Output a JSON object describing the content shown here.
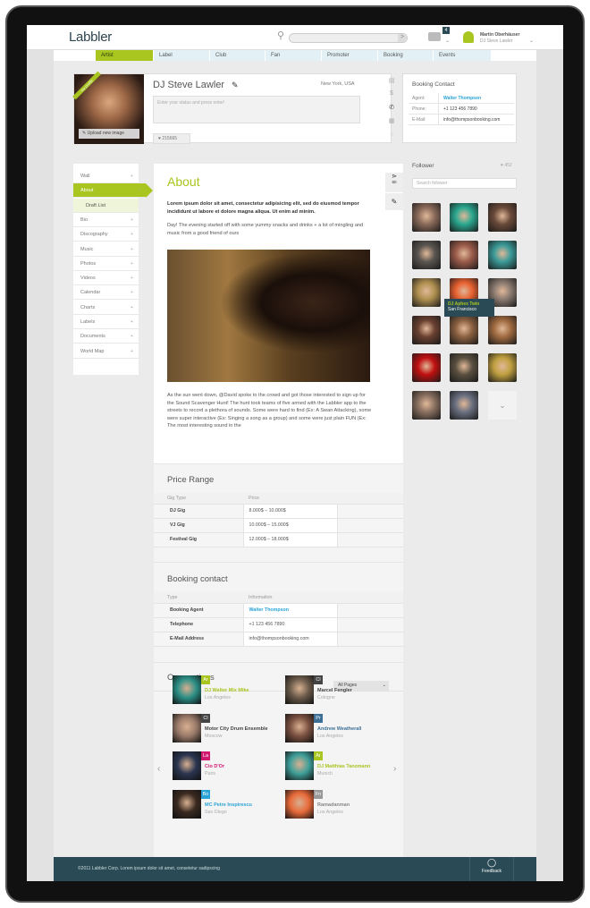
{
  "colors": {
    "accent": "#a8c520",
    "link": "#2aa3d6",
    "footer": "#2a4a55"
  },
  "header": {
    "logo": "Labbler",
    "search_placeholder": "",
    "search_go": ">",
    "notifications": "4",
    "user_name": "Martin Oberhäuser",
    "user_sub": "DJ Steve Lawler"
  },
  "nav": [
    "Artist",
    "Label",
    "Club",
    "Fan",
    "Promoter",
    "Booking",
    "Events"
  ],
  "profile": {
    "ribbon": "my profile",
    "upload": "Upload new image",
    "name": "DJ Steve Lawler",
    "location": "New York, USA",
    "status_placeholder": "Enter your status and press enter!",
    "likes": "215665"
  },
  "booking_card": {
    "title": "Booking Contact",
    "rows": [
      {
        "k": "Agent:",
        "v": "Walter Thompson",
        "link": true
      },
      {
        "k": "Phone:",
        "v": "+1 123 456 7890"
      },
      {
        "k": "E-Mail:",
        "v": "info@thompsonbooking.com"
      }
    ]
  },
  "menu": [
    {
      "label": "Wall",
      "sign": "+"
    },
    {
      "label": "About",
      "sign": "–",
      "active": true
    },
    {
      "label": "Draft List",
      "sub": true
    },
    {
      "label": "Bio",
      "sign": "+"
    },
    {
      "label": "Discography",
      "sign": "+"
    },
    {
      "label": "Music",
      "sign": "+"
    },
    {
      "label": "Photos",
      "sign": "+"
    },
    {
      "label": "Videos",
      "sign": "+"
    },
    {
      "label": "Calendar",
      "sign": "+"
    },
    {
      "label": "Charts",
      "sign": "+"
    },
    {
      "label": "Labels",
      "sign": "+"
    },
    {
      "label": "Documents",
      "sign": "+"
    },
    {
      "label": "World Map",
      "sign": "+"
    }
  ],
  "about": {
    "title": "About",
    "share_count": "80",
    "lead": "Lorem ipsum dolor sit amet, consectetur adipisicing elit, sed do eiusmod tempor incididunt ut labore et dolore magna aliqua. Ut enim ad minim.",
    "p1": "Day! The evening started off with some yummy snacks and drinks + a lot of mingling and music from a good friend of ours",
    "p2": "As the sun went down, @David spoke to the crowd and got those interested to sign up for the Sound Scavenger Hunt! The hunt took teams of five armed with the Labbler app to the streets to record a plethora of sounds. Some were hard to find (Ex: A Swan Attacking), some were super interactive (Ex: Singing a song as a group) and some were just plain FUN (Ex: The most interesting sound in the"
  },
  "price": {
    "title": "Price Range",
    "headers": [
      "Gig Type",
      "Price"
    ],
    "rows": [
      [
        "DJ Gig",
        "8.000$ – 10.000$"
      ],
      [
        "VJ Gig",
        "10.000$ – 15.000$"
      ],
      [
        "Festival Gig",
        "12.000$ – 18.000$"
      ]
    ]
  },
  "contact": {
    "title": "Booking contact",
    "headers": [
      "Type",
      "Information"
    ],
    "rows": [
      [
        "Booking Agent",
        "Walter Thompson"
      ],
      [
        "Telephone",
        "+1 123 456 7890"
      ],
      [
        "E-Mail Address",
        "info@thompsonbooking.com"
      ]
    ]
  },
  "connections": {
    "title": "Connections",
    "filter": "All Pages",
    "items": [
      {
        "tag": "Ar",
        "tagc": "#a8c520",
        "name": "DJ Walter Mix Mike",
        "namec": "#a8c520",
        "city": "Los Angeles",
        "pic": "#2b8f86"
      },
      {
        "tag": "Cl",
        "tagc": "#444",
        "name": "Marcel Fengler",
        "namec": "#444",
        "city": "Cologne",
        "pic": "#6a5a4a"
      },
      {
        "tag": "Cl",
        "tagc": "#444",
        "name": "Motor City Drum Ensemble",
        "namec": "#444",
        "city": "Moscow",
        "pic": "#9a7a6a"
      },
      {
        "tag": "Pr",
        "tagc": "#3d6f95",
        "name": "Andrew Weatherall",
        "namec": "#3d6f95",
        "city": "Los Angeles",
        "pic": "#7a5040"
      },
      {
        "tag": "La",
        "tagc": "#d0186f",
        "name": "Cio D'Or",
        "namec": "#d0186f",
        "city": "Paris",
        "pic": "#2a3550"
      },
      {
        "tag": "Ar",
        "tagc": "#a8c520",
        "name": "DJ Matthias Tanzmann",
        "namec": "#a8c520",
        "city": "Munich",
        "pic": "#3f9f9a"
      },
      {
        "tag": "Bo",
        "tagc": "#2aa3d6",
        "name": "MC Petre Inspirescu",
        "namec": "#2aa3d6",
        "city": "San Diego",
        "pic": "#3a2a20"
      },
      {
        "tag": "Fn",
        "tagc": "#999",
        "name": "Ramadanman",
        "namec": "#888",
        "city": "Los Angeles",
        "pic": "#e86a3a"
      }
    ]
  },
  "followers": {
    "title": "Follower",
    "count": "452",
    "search_placeholder": "Search follower",
    "tooltip_name": "DJ Aphex Twin",
    "tooltip_city": "San Francisco",
    "avatars": [
      "#8a6a5a",
      "#2aa890",
      "#6a4a3a",
      "#5a5550",
      "#9a5a4a",
      "#3a9a98",
      "#b09050",
      "#e86030",
      "#8a7a70",
      "#6a4030",
      "#8a6040",
      "#a06a40",
      "#c01010",
      "#5a5040",
      "#c0a040",
      "#8a7060",
      "#6a7080"
    ]
  },
  "footer": {
    "copyright": "©2011 Labbler Corp. Lorem ipsum dolor sit amet, consetetur sadipscing",
    "feedback": "Feedback"
  }
}
